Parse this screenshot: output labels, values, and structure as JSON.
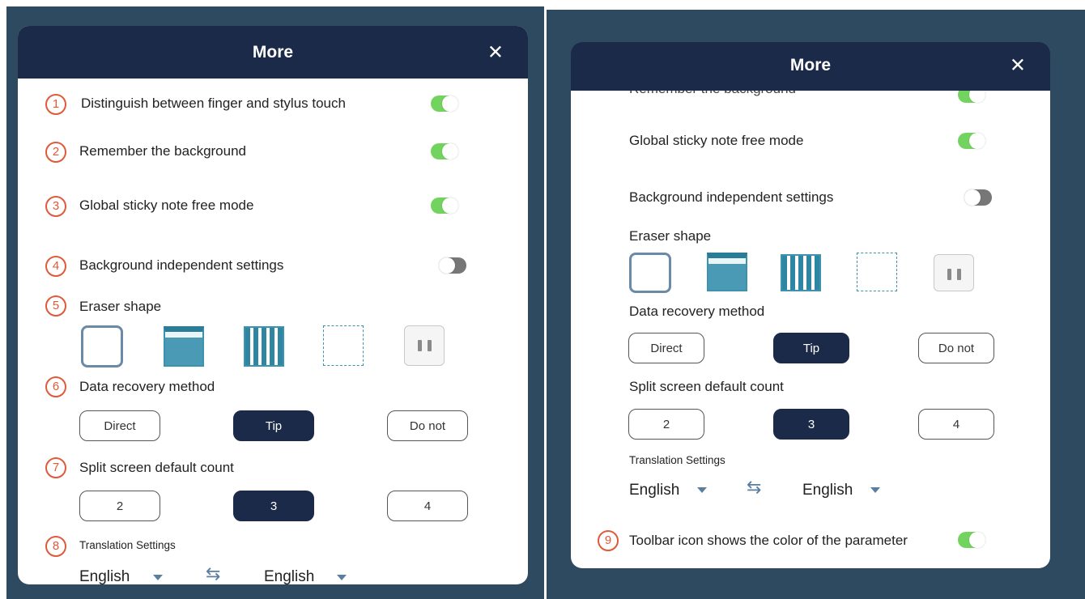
{
  "left_panel": {
    "title": "More",
    "close_glyph": "✕",
    "rows": [
      {
        "num": "1",
        "label": "Distinguish between finger and stylus touch",
        "toggle": "on"
      },
      {
        "num": "2",
        "label": "Remember the background",
        "toggle": "on"
      },
      {
        "num": "3",
        "label": "Global sticky note free mode",
        "toggle": "on"
      },
      {
        "num": "4",
        "label": "Background independent settings",
        "toggle": "off"
      }
    ],
    "eraser": {
      "num": "5",
      "label": "Eraser shape"
    },
    "recovery": {
      "num": "6",
      "label": "Data recovery method",
      "options": [
        "Direct",
        "Tip",
        "Do not"
      ],
      "selected": "Tip"
    },
    "split": {
      "num": "7",
      "label": "Split screen default count",
      "options": [
        "2",
        "3",
        "4"
      ],
      "selected": "3"
    },
    "translation": {
      "num": "8",
      "label": "Translation Settings",
      "from": "English",
      "to": "English",
      "swap_glyph": "⇆"
    }
  },
  "right_panel": {
    "title": "More",
    "close_glyph": "✕",
    "partial_row_label": "Remember the background",
    "rows": [
      {
        "label": "Global sticky note free mode",
        "toggle": "on"
      },
      {
        "label": "Background independent settings",
        "toggle": "off"
      }
    ],
    "eraser_label": "Eraser shape",
    "recovery": {
      "label": "Data recovery method",
      "options": [
        "Direct",
        "Tip",
        "Do not"
      ],
      "selected": "Tip"
    },
    "split": {
      "label": "Split screen default count",
      "options": [
        "2",
        "3",
        "4"
      ],
      "selected": "3"
    },
    "translation": {
      "label": "Translation Settings",
      "from": "English",
      "to": "English",
      "swap_glyph": "⇆"
    },
    "toolbar_row": {
      "num": "9",
      "label": "Toolbar icon shows the color of the parameter",
      "toggle": "on"
    }
  },
  "colors": {
    "background": "#2d4a60",
    "header": "#1b2a48",
    "toggle_on": "#72d45f",
    "toggle_off": "#777777",
    "annotation": "#e05a3a",
    "eraser_accent": "#4a9ab5"
  },
  "icons": [
    "close-icon",
    "dropdown-caret-icon",
    "swap-icon"
  ]
}
